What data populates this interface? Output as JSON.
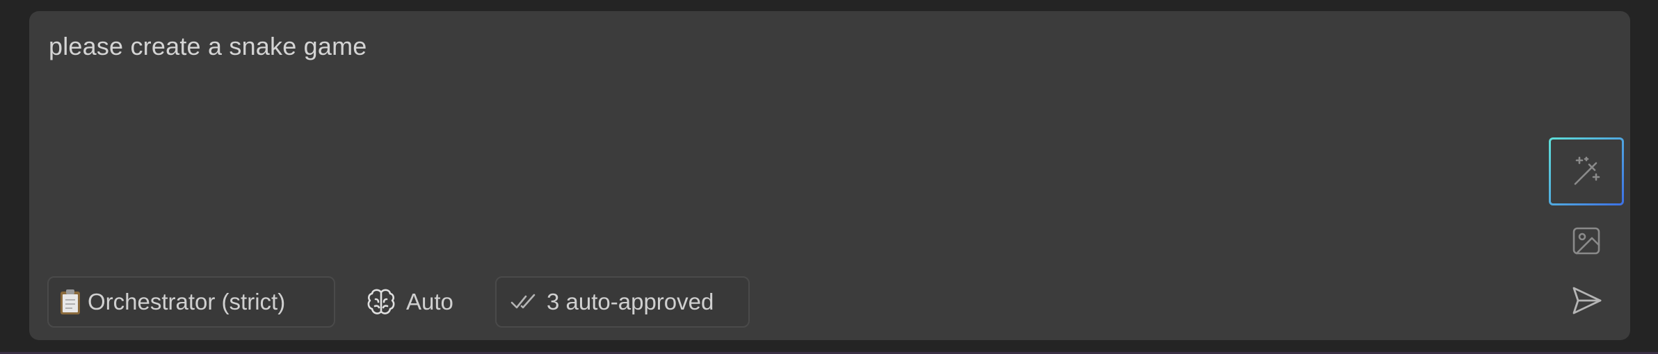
{
  "composer": {
    "prompt_text": "please create a snake game"
  },
  "toolbar": {
    "mode_label": "Orchestrator (strict)",
    "mode_icon": "clipboard-icon",
    "model_label": "Auto",
    "model_icon": "brain-icon",
    "auto_approve_label": "3 auto-approved",
    "auto_approve_icon": "double-check-icon"
  },
  "actions": {
    "enhance_icon": "magic-wand-icon",
    "image_icon": "image-icon",
    "send_icon": "send-icon"
  },
  "colors": {
    "background": "#242424",
    "composer_bg": "#3c3c3c",
    "text": "#d4d4d4",
    "accent_gradient_start": "#5ee0d8",
    "accent_gradient_end": "#3c6fe6"
  }
}
